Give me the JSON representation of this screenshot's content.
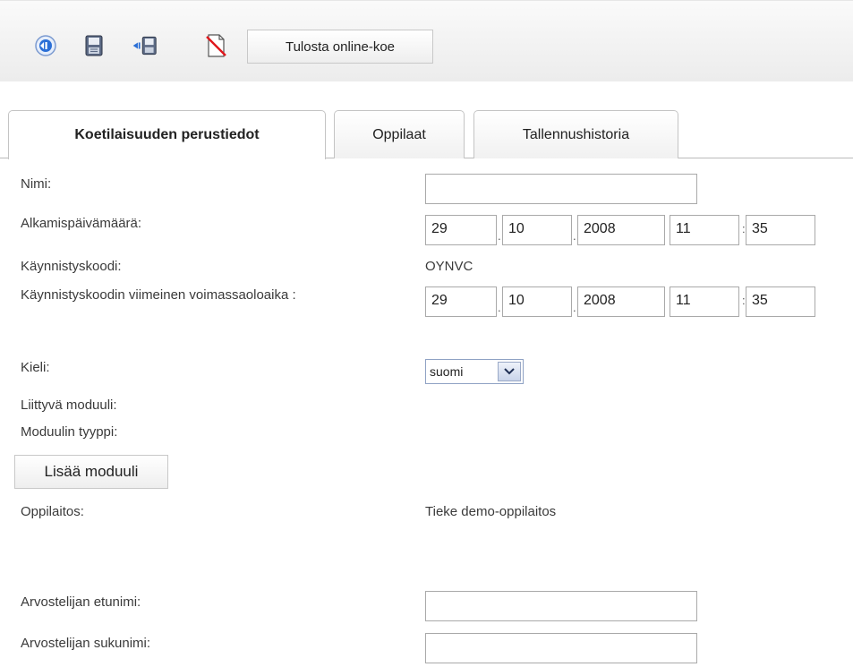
{
  "toolbar": {
    "icons": [
      "back-icon",
      "save-icon",
      "save-and-back-icon",
      "no-print-icon"
    ],
    "print_label": "Tulosta online-koe"
  },
  "tabs": [
    {
      "label": "Koetilaisuuden perustiedot",
      "active": true
    },
    {
      "label": "Oppilaat",
      "active": false
    },
    {
      "label": "Tallennushistoria",
      "active": false
    }
  ],
  "form": {
    "name_label": "Nimi:",
    "name_value": "",
    "start_label": "Alkamispäivämäärä:",
    "start": {
      "day": "29",
      "month": "10",
      "year": "2008",
      "hour": "11",
      "minute": "35"
    },
    "code_label": "Käynnistyskoodi:",
    "code_value": "OYNVC",
    "code_expiry_label": "Käynnistyskoodin viimeinen voimassaoloaika :",
    "code_expiry": {
      "day": "29",
      "month": "10",
      "year": "2008",
      "hour": "11",
      "minute": "35"
    },
    "language_label": "Kieli:",
    "language_value": "suomi",
    "module_label": "Liittyvä moduuli:",
    "module_type_label": "Moduulin tyyppi:",
    "add_module_label": "Lisää moduuli",
    "school_label": "Oppilaitos:",
    "school_value": "Tieke demo-oppilaitos",
    "grader_first_label": "Arvostelijan etunimi:",
    "grader_first_value": "",
    "grader_last_label": "Arvostelijan sukunimi:",
    "grader_last_value": ""
  },
  "colors": {
    "accent": "#2b6fd6",
    "toolbar_bg": "#f0f0f0",
    "border": "#a9a9a9"
  }
}
